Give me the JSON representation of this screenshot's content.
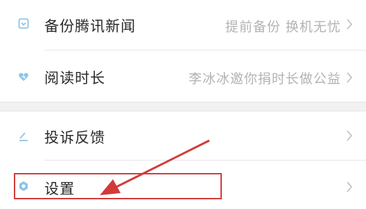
{
  "menu": {
    "items": [
      {
        "label": "备份腾讯新闻",
        "subtitle": "提前备份 换机无忧",
        "icon": "backup-icon"
      },
      {
        "label": "阅读时长",
        "subtitle": "李冰冰邀你捐时长做公益",
        "icon": "heart-icon"
      },
      {
        "label": "投诉反馈",
        "subtitle": "",
        "icon": "pencil-icon"
      },
      {
        "label": "设置",
        "subtitle": "",
        "icon": "settings-gear-icon"
      }
    ]
  },
  "annotation": {
    "highlight_color": "#d23a3a",
    "target": "设置"
  },
  "colors": {
    "icon_blue": "#8fc3e6",
    "label_text": "#2a2a2a",
    "subtitle_text": "#b3b3b3",
    "chevron": "#bdbdbd",
    "section_gap": "#f1f1f1"
  }
}
